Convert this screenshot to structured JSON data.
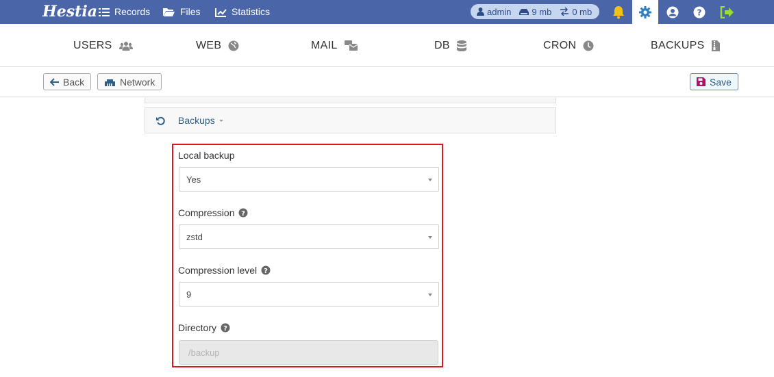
{
  "app": {
    "logo": "Hestia"
  },
  "topnav": {
    "records": "Records",
    "files": "Files",
    "statistics": "Statistics"
  },
  "user": {
    "name": "admin",
    "disk": "9 mb",
    "bandwidth": "0 mb"
  },
  "secnav": {
    "users": "USERS",
    "web": "WEB",
    "mail": "MAIL",
    "db": "DB",
    "cron": "CRON",
    "backups": "BACKUPS"
  },
  "toolbar": {
    "back": "Back",
    "network": "Network",
    "save": "Save"
  },
  "section": {
    "title": "Backups"
  },
  "form": {
    "local_backup": {
      "label": "Local backup",
      "value": "Yes"
    },
    "compression": {
      "label": "Compression",
      "value": "zstd"
    },
    "compression_level": {
      "label": "Compression level",
      "value": "9"
    },
    "directory": {
      "label": "Directory",
      "placeholder": "/backup"
    }
  },
  "colors": {
    "topbar": "#4b66a8",
    "link": "#2d5f8b",
    "highlight": "#d9161c",
    "bell": "#f5c017",
    "logout": "#9adb3c",
    "gear": "#2d7fc1"
  }
}
